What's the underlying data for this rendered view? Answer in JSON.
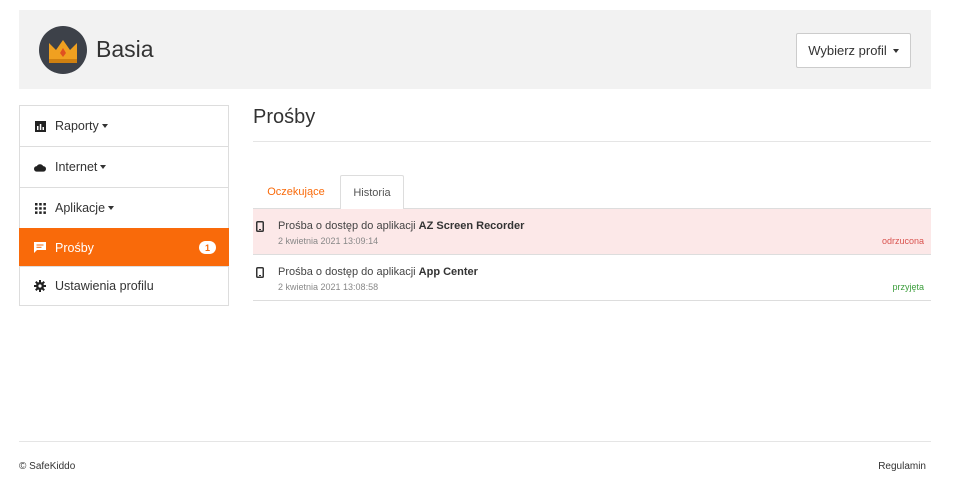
{
  "header": {
    "profile_name": "Basia",
    "select_profile_label": "Wybierz profil",
    "avatar_icon": "crown-icon"
  },
  "sidebar": {
    "items": [
      {
        "label": "Raporty",
        "icon": "bar-chart-icon",
        "dropdown": true
      },
      {
        "label": "Internet",
        "icon": "cloud-icon",
        "dropdown": true
      },
      {
        "label": "Aplikacje",
        "icon": "grid-icon",
        "dropdown": true
      },
      {
        "label": "Prośby",
        "icon": "message-icon",
        "badge": "1",
        "active": true
      },
      {
        "label": "Ustawienia profilu",
        "icon": "gear-icon"
      }
    ]
  },
  "main": {
    "title": "Prośby",
    "tabs": [
      {
        "label": "Oczekujące"
      },
      {
        "label": "Historia",
        "active": true
      }
    ],
    "requests": [
      {
        "prefix": "Prośba o dostęp do aplikacji",
        "app": "AZ Screen Recorder",
        "date": "2 kwietnia 2021 13:09:14",
        "status": "odrzucona",
        "status_color": "#d9534f"
      },
      {
        "prefix": "Prośba o dostęp do aplikacji",
        "app": "App Center",
        "date": "2 kwietnia 2021 13:08:58",
        "status": "przyjęta",
        "status_color": "#3c9e3c"
      }
    ]
  },
  "footer": {
    "copyright": "© SafeKiddo",
    "terms": "Regulamin"
  },
  "colors": {
    "accent": "#f96a0a",
    "rejected_bg": "#fce8e8"
  }
}
